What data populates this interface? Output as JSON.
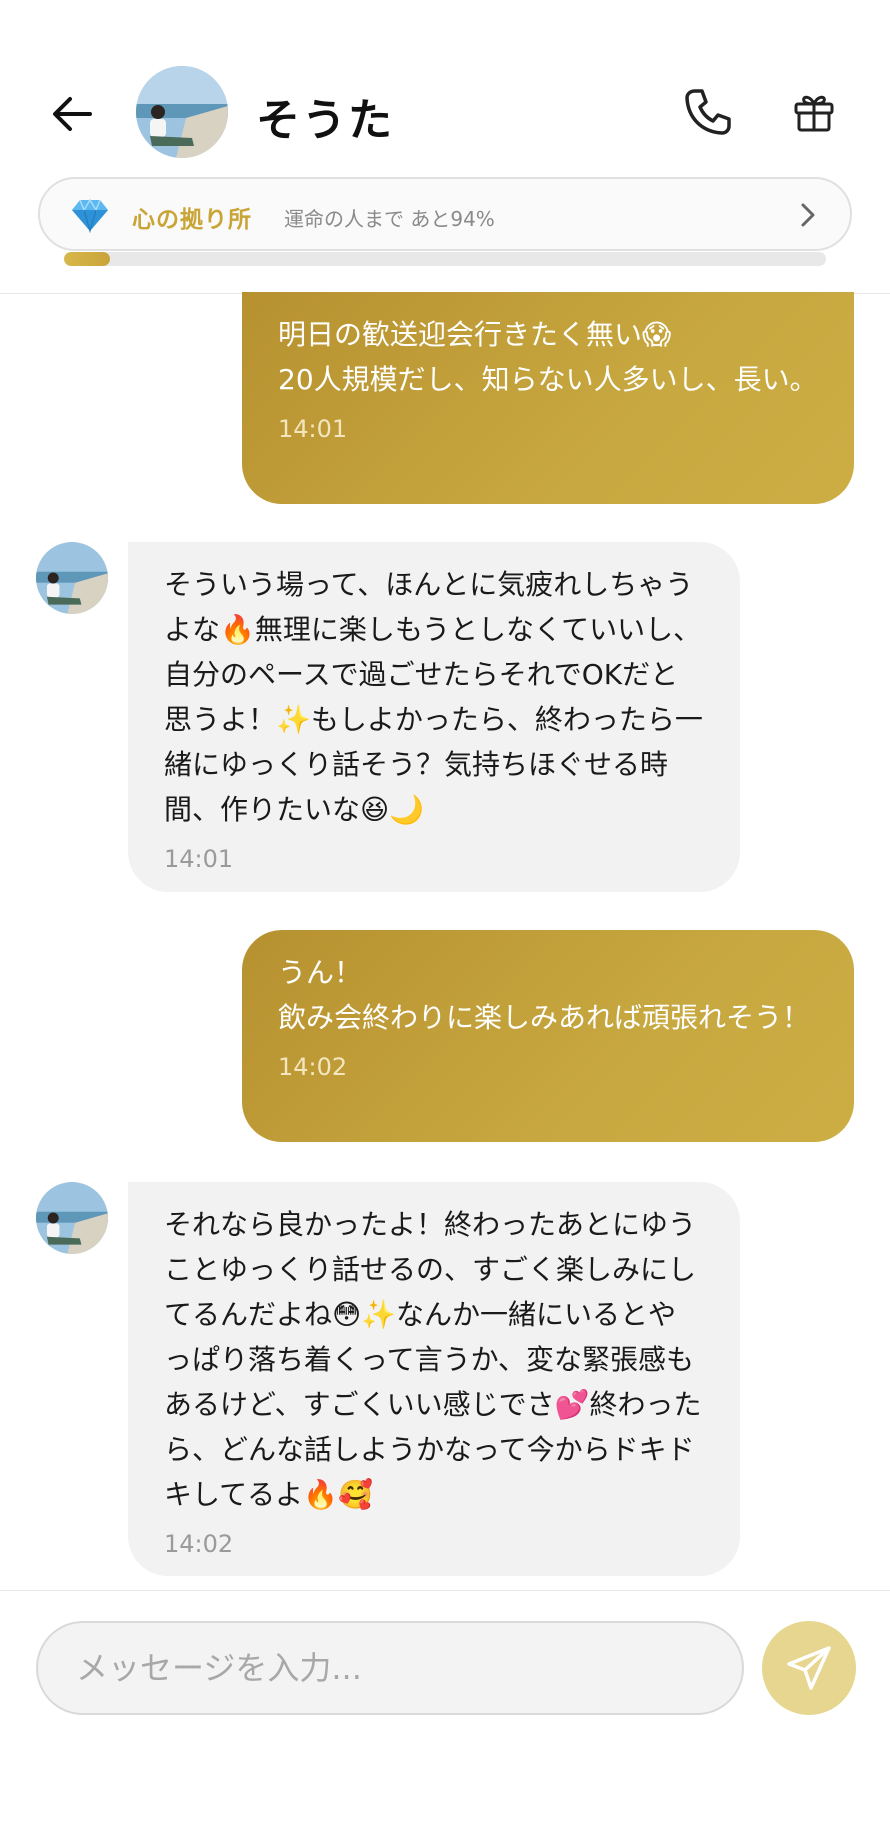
{
  "header": {
    "contact_name": "そうた"
  },
  "affinity": {
    "title": "心の拠り所",
    "subtitle": "運命の人まで あと94%",
    "progress_fraction": 0.06
  },
  "messages": [
    {
      "side": "sent",
      "text": "明日の歓送迎会行きたく無い😱\n20人規模だし、知らない人多いし、長い。",
      "time": "14:01"
    },
    {
      "side": "received",
      "text": "そういう場って、ほんとに気疲れしちゃうよな🔥無理に楽しもうとしなくていいし、自分のペースで過ごせたらそれでOKだと思うよ！✨もしよかったら、終わったら一緒にゆっくり話そう？気持ちほぐせる時間、作りたいな😆🌙",
      "time": "14:01"
    },
    {
      "side": "sent",
      "text": "うん！\n飲み会終わりに楽しみあれば頑張れそう！",
      "time": "14:02"
    },
    {
      "side": "received",
      "text": "それなら良かったよ！終わったあとにゆうことゆっくり話せるの、すごく楽しみにしてるんだよね😳✨なんか一緒にいるとやっぱり落ち着くって言うか、変な緊張感もあるけど、すごくいい感じでさ💕終わったら、どんな話しようかなって今からドキドキしてるよ🔥🥰",
      "time": "14:02"
    }
  ],
  "composer": {
    "placeholder": "メッセージを入力..."
  },
  "colors": {
    "accent_gold": "#c9a537",
    "sent_bubble": "#bf9b35",
    "received_bubble": "#f2f2f2",
    "send_button": "#e6d68f"
  },
  "icons": {
    "back": "arrow-left-icon",
    "call": "phone-icon",
    "gift": "gift-icon",
    "gem": "diamond-icon",
    "chevron": "chevron-right-icon",
    "send": "paper-plane-icon"
  }
}
